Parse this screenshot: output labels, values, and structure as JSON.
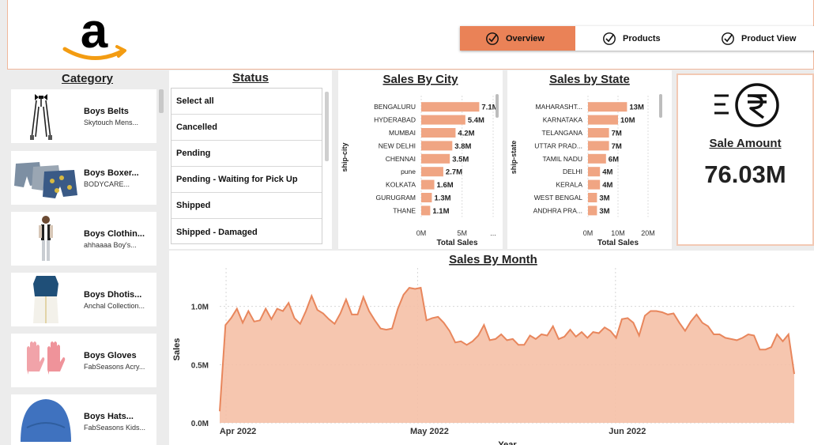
{
  "header": {
    "logo_icon": "amazon-logo",
    "tabs": [
      {
        "label": "Overview",
        "active": true
      },
      {
        "label": "Products",
        "active": false
      },
      {
        "label": "Product View",
        "active": false
      }
    ]
  },
  "category": {
    "title": "Category",
    "items": [
      {
        "name": "Boys Belts",
        "sub": "Skytouch Mens...",
        "icon": "suspenders-icon"
      },
      {
        "name": "Boys Boxer...",
        "sub": "BODYCARE...",
        "icon": "boxers-icon"
      },
      {
        "name": "Boys Clothin...",
        "sub": "ahhaaaa Boy's...",
        "icon": "boy-clothing-icon"
      },
      {
        "name": "Boys Dhotis...",
        "sub": "Anchal Collection...",
        "icon": "dhoti-icon"
      },
      {
        "name": "Boys Gloves",
        "sub": "FabSeasons Acry...",
        "icon": "gloves-icon"
      },
      {
        "name": "Boys Hats...",
        "sub": "FabSeasons Kids...",
        "icon": "hat-icon"
      }
    ]
  },
  "status": {
    "title": "Status",
    "items": [
      "Select all",
      "Cancelled",
      "Pending",
      "Pending - Waiting for Pick Up",
      "Shipped",
      "Shipped - Damaged"
    ]
  },
  "kpi": {
    "icon": "rupee-icon",
    "label": "Sale Amount",
    "value": "76.03M"
  },
  "colors": {
    "accent": "#ea8257",
    "bar": "#f0a583",
    "area": "#f5c0a6",
    "line": "#e8865c"
  },
  "chart_data": [
    {
      "type": "bar",
      "orientation": "horizontal",
      "title": "Sales By City",
      "xlabel": "Total Sales",
      "ylabel": "ship-city",
      "categories": [
        "BENGALURU",
        "HYDERABAD",
        "MUMBAI",
        "NEW DELHI",
        "CHENNAI",
        "pune",
        "KOLKATA",
        "GURUGRAM",
        "THANE"
      ],
      "values": [
        7.1,
        5.4,
        4.2,
        3.8,
        3.5,
        2.7,
        1.6,
        1.3,
        1.1
      ],
      "labels": [
        "7.1M",
        "5.4M",
        "4.2M",
        "3.8M",
        "3.5M",
        "2.7M",
        "1.6M",
        "1.3M",
        "1.1M"
      ],
      "xticks": [
        "0M",
        "5M",
        "..."
      ],
      "xtick_values": [
        0,
        5,
        8.8
      ],
      "xlim": [
        0,
        8.8
      ]
    },
    {
      "type": "bar",
      "orientation": "horizontal",
      "title": "Sales by State",
      "xlabel": "Total Sales",
      "ylabel": "ship-state",
      "categories": [
        "MAHARASHT...",
        "KARNATAKA",
        "TELANGANA",
        "UTTAR PRAD...",
        "TAMIL NADU",
        "DELHI",
        "KERALA",
        "WEST BENGAL",
        "ANDHRA PRA..."
      ],
      "values": [
        13,
        10,
        7,
        7,
        6,
        4,
        4,
        3,
        3
      ],
      "labels": [
        "13M",
        "10M",
        "7M",
        "7M",
        "6M",
        "4M",
        "4M",
        "3M",
        "3M"
      ],
      "xticks": [
        "0M",
        "10M",
        "20M"
      ],
      "xtick_values": [
        0,
        10,
        20
      ],
      "xlim": [
        0,
        20
      ]
    },
    {
      "type": "area",
      "title": "Sales By Month",
      "xlabel": "Year",
      "ylabel": "Sales",
      "x_start": "2022-03-31",
      "x_end": "2022-06-29",
      "xticks": [
        {
          "label": "Apr 2022",
          "date": "2022-04-01"
        },
        {
          "label": "May 2022",
          "date": "2022-05-01"
        },
        {
          "label": "Jun 2022",
          "date": "2022-06-01"
        }
      ],
      "yticks": [
        {
          "label": "0.0M",
          "value": 0
        },
        {
          "label": "0.5M",
          "value": 0.5
        },
        {
          "label": "1.0M",
          "value": 1.0
        }
      ],
      "ylim": [
        0,
        1.33
      ],
      "values": [
        0.1,
        0.84,
        0.9,
        0.98,
        0.86,
        0.96,
        0.87,
        0.88,
        0.98,
        0.89,
        0.98,
        0.96,
        1.03,
        0.9,
        0.85,
        0.96,
        1.09,
        0.97,
        0.94,
        0.89,
        0.85,
        0.94,
        1.06,
        0.93,
        0.93,
        1.08,
        0.96,
        0.88,
        0.81,
        0.8,
        0.81,
        0.98,
        1.1,
        1.16,
        1.15,
        1.16,
        0.88,
        0.9,
        0.91,
        0.86,
        0.79,
        0.69,
        0.7,
        0.67,
        0.7,
        0.75,
        0.84,
        0.71,
        0.72,
        0.76,
        0.71,
        0.72,
        0.67,
        0.67,
        0.75,
        0.72,
        0.76,
        0.75,
        0.83,
        0.72,
        0.74,
        0.8,
        0.74,
        0.78,
        0.73,
        0.78,
        0.77,
        0.82,
        0.79,
        0.73,
        0.89,
        0.9,
        0.86,
        0.75,
        0.92,
        0.96,
        0.96,
        0.95,
        0.93,
        0.94,
        0.86,
        0.79,
        0.87,
        0.93,
        0.86,
        0.83,
        0.76,
        0.76,
        0.73,
        0.72,
        0.71,
        0.73,
        0.76,
        0.75,
        0.63,
        0.63,
        0.65,
        0.76,
        0.7,
        0.76,
        0.42
      ]
    }
  ]
}
